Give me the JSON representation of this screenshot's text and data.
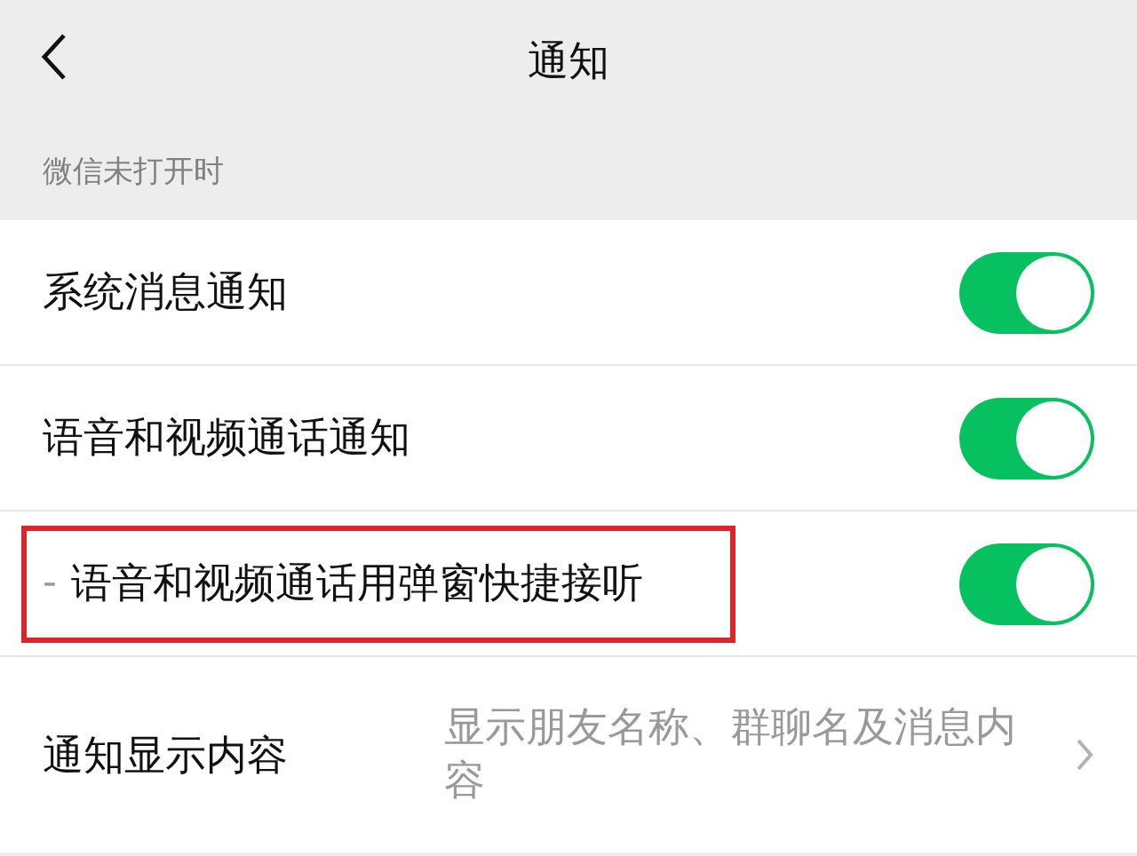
{
  "header": {
    "title": "通知"
  },
  "section": {
    "label": "微信未打开时"
  },
  "settings": [
    {
      "kind": "toggle",
      "label": "系统消息通知",
      "on": true,
      "highlighted": false
    },
    {
      "kind": "toggle",
      "label": "语音和视频通话通知",
      "on": true,
      "highlighted": false
    },
    {
      "kind": "toggle",
      "prefix": "-",
      "label": "语音和视频通话用弹窗快捷接听",
      "on": true,
      "highlighted": true
    },
    {
      "kind": "link",
      "label": "通知显示内容",
      "value": "显示朋友名称、群聊名及消息内容",
      "highlighted": false
    }
  ]
}
